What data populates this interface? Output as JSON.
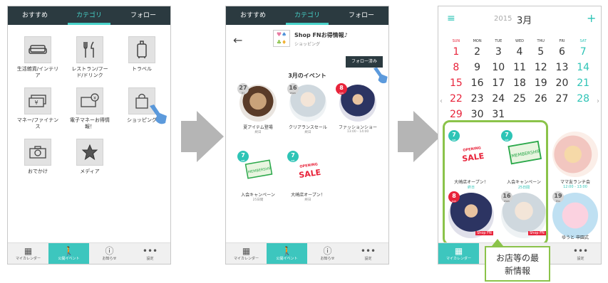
{
  "tabs": [
    "おすすめ",
    "カテゴリ",
    "フォロー"
  ],
  "bottom_nav": [
    {
      "label": "マイカレンダー",
      "icon": "calendar-icon"
    },
    {
      "label": "公開イベント",
      "icon": "walking-person-icon"
    },
    {
      "label": "お知らせ",
      "icon": "info-icon"
    },
    {
      "label": "設定",
      "icon": "more-dots-icon"
    }
  ],
  "screen1": {
    "categories": [
      {
        "label": "生活雑貨/インテリア",
        "icon": "sofa-icon"
      },
      {
        "label": "レストラン/フード/ドリンク",
        "icon": "cutlery-icon"
      },
      {
        "label": "トラベル",
        "icon": "suitcase-icon"
      },
      {
        "label": "マネー/ファイナンス",
        "icon": "money-icon"
      },
      {
        "label": "電子マネーお得情報！",
        "icon": "emoney-card-icon"
      },
      {
        "label": "ショッピング",
        "icon": "shopping-bag-icon"
      },
      {
        "label": "おでかけ",
        "icon": "camera-icon"
      },
      {
        "label": "メディア",
        "icon": "star-icon"
      }
    ]
  },
  "screen2": {
    "shop_name": "Shop FNお得情報♪",
    "shop_category": "ショッピング",
    "follow_button": "フォロー済み",
    "section_title": "3月のイベント",
    "events": [
      {
        "title": "夏アイテム登場",
        "sub": "終日",
        "day": "27",
        "dow": "fri",
        "badge": "grey"
      },
      {
        "title": "クリアランスセール",
        "sub": "終日",
        "day": "16",
        "dow": "mon",
        "badge": "grey"
      },
      {
        "title": "ファッションショー",
        "sub": "13:00 - 14:00",
        "day": "8",
        "dow": "sun",
        "badge": "red"
      },
      {
        "title": "入会キャンペーン",
        "sub": "25日間",
        "day": "7",
        "dow": "sat",
        "badge": "teal"
      },
      {
        "title": "大崎店オープン！",
        "sub": "終日",
        "day": "7",
        "dow": "sat",
        "badge": "teal"
      }
    ]
  },
  "screen3": {
    "year": "2015",
    "month": "3月",
    "dow": [
      "SUN",
      "MON",
      "TUE",
      "WED",
      "THU",
      "FRI",
      "SAT"
    ],
    "weeks": [
      [
        "1",
        "2",
        "3",
        "4",
        "5",
        "6",
        "7"
      ],
      [
        "8",
        "9",
        "10",
        "11",
        "12",
        "13",
        "14"
      ],
      [
        "15",
        "16",
        "17",
        "18",
        "19",
        "20",
        "21"
      ],
      [
        "22",
        "23",
        "24",
        "25",
        "26",
        "27",
        "28"
      ],
      [
        "29",
        "30",
        "31",
        "",
        "",
        "",
        ""
      ]
    ],
    "cards": [
      {
        "title": "大崎店オープン！",
        "sub": "終日",
        "day": "7",
        "dow": "sat"
      },
      {
        "title": "入会キャンペーン",
        "sub": "25日間",
        "day": "7",
        "dow": "sat"
      },
      {
        "title": "ママ友ランチ会",
        "sub": "12:00 - 13:00",
        "day": "",
        "dow": ""
      },
      {
        "title": "",
        "sub": "",
        "day": "8",
        "dow": "sun"
      },
      {
        "title": "",
        "sub": "",
        "day": "16",
        "dow": "mon"
      },
      {
        "title": "ゆうと 卒園式",
        "sub": "",
        "day": "19",
        "dow": "thu"
      }
    ],
    "shop_tag": "Shop FN",
    "callout": "お店等の最新情報"
  },
  "decor": {
    "sale_text": "SALE",
    "opening_text": "OPENING",
    "membership_text": "MEMBERSHIP"
  },
  "colors": {
    "accent": "#2ec4b6",
    "header": "#2b3a40",
    "red": "#e8243b",
    "highlight": "#8bc34a"
  }
}
